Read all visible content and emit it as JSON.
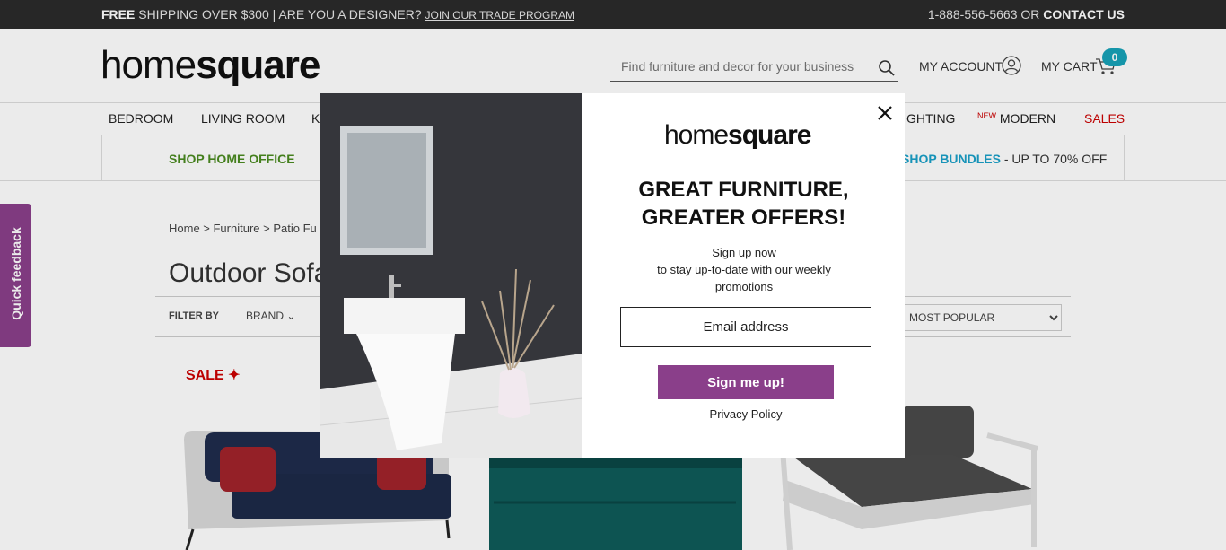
{
  "topbar": {
    "free_bold": "FREE",
    "free_text": "SHIPPING OVER $300",
    "separator": "|",
    "designer_q": "ARE YOU A DESIGNER?",
    "trade_link": "JOIN OUR TRADE PROGRAM",
    "phone": "1-888-556-5663 OR",
    "contact": "CONTACT US"
  },
  "header": {
    "logo_thin": "home",
    "logo_bold": "square",
    "search_placeholder": "Find furniture and decor for your business",
    "account_label": "MY ACCOUNT",
    "cart_label": "MY CART",
    "cart_count": "0"
  },
  "nav": {
    "items": [
      "BEDROOM",
      "LIVING ROOM",
      "K",
      "GHTING",
      "MODERN",
      "SALES"
    ],
    "new_tag": "NEW"
  },
  "promo": {
    "left": "SHOP HOME OFFICE",
    "right_bold": "SHOP BUNDLES",
    "right_text": "- UP TO 70% OFF"
  },
  "page": {
    "breadcrumb": "Home  >  Furniture  >  Patio Fu",
    "title": "Outdoor Sofa",
    "filter_by": "FILTER BY",
    "brand": "BRAND",
    "sort_selected": "MOST POPULAR",
    "sale_badge": "SALE"
  },
  "feedback": {
    "label": "Quick feedback"
  },
  "modal": {
    "logo_thin": "home",
    "logo_bold": "square",
    "headline_1": "GREAT FURNITURE,",
    "headline_2": "GREATER OFFERS!",
    "sub_1": "Sign up now",
    "sub_2": "to stay up-to-date with our weekly promotions",
    "email_placeholder": "Email address",
    "button": "Sign me up!",
    "privacy": "Privacy Policy"
  },
  "colors": {
    "accent_purple": "#8a3f8a",
    "cart_badge": "#17a2b8",
    "sale_red": "#cc0000",
    "promo_green": "#4a8a20",
    "promo_blue": "#1aa0c8"
  }
}
